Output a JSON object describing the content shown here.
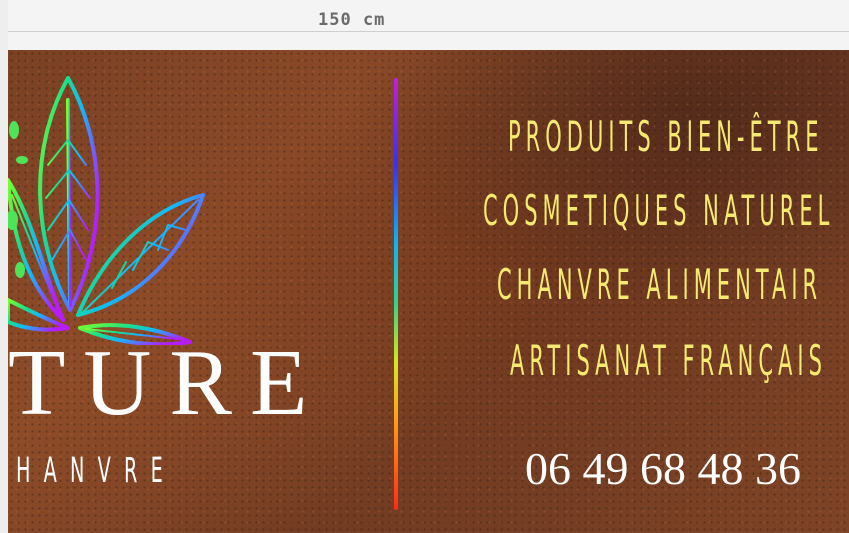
{
  "dimension_label": "150 cm",
  "brand": {
    "name": "TURE",
    "subtitle": "HANVRE"
  },
  "products": [
    "PRODUITS BIEN-ÊTRE",
    "COSMETIQUES NATUREL",
    "CHANVRE ALIMENTAIR",
    "ARTISANAT FRANÇAIS"
  ],
  "phone": "06 49 68 48 36",
  "colors": {
    "background": "#7a4124",
    "product_text": "#f4ea72",
    "brand_text": "#ffffff"
  }
}
